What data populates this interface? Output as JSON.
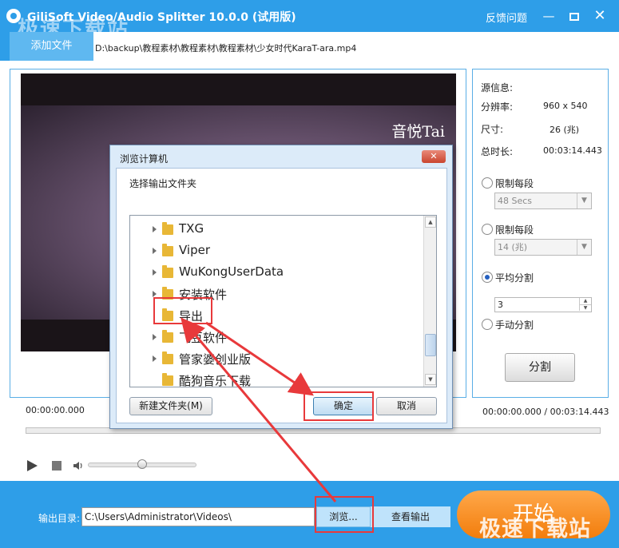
{
  "window": {
    "title": "GiliSoft Video/Audio Splitter 10.0.0 (试用版)",
    "feedback": "反馈问题",
    "minimize": "—",
    "close": "✕",
    "watermark": "极速下载站"
  },
  "toolbar": {
    "add_file": "添加文件",
    "file_path": "D:\\backup\\教程素材\\教程素材\\教程素材\\少女时代KaraT-ara.mp4"
  },
  "video": {
    "caption": "音悦Tai"
  },
  "info": {
    "source_label": "源信息:",
    "resolution_label": "分辨率:",
    "resolution_value": "960 x 540",
    "size_label": "尺寸:",
    "size_value": "26 (兆)",
    "duration_label": "总时长:",
    "duration_value": "00:03:14.443"
  },
  "split_options": {
    "limit_time_label": "限制每段",
    "limit_time_value": "48 Secs",
    "limit_size_label": "限制每段",
    "limit_size_value": "14 (兆)",
    "average_label": "平均分割",
    "average_value": "3",
    "manual_label": "手动分割",
    "split_button": "分割",
    "selected": "average"
  },
  "timeline": {
    "time_left": "00:00:00.000",
    "time_right": "00:00:00.000 / 00:03:14.443",
    "volume": 0.5
  },
  "output": {
    "label": "输出目录:",
    "path": "C:\\Users\\Administrator\\Videos\\",
    "browse": "浏览...",
    "view_output": "查看输出",
    "start": "开始"
  },
  "dialog": {
    "title": "浏览计算机",
    "close": "✕",
    "prompt": "选择输出文件夹",
    "folders": [
      {
        "name": "TXG",
        "has_children": true
      },
      {
        "name": "Viper",
        "has_children": true
      },
      {
        "name": "WuKongUserData",
        "has_children": true
      },
      {
        "name": "安装软件",
        "has_children": true
      },
      {
        "name": "导出",
        "has_children": false,
        "selected": true
      },
      {
        "name": "飞豆软件",
        "has_children": true
      },
      {
        "name": "管家婆创业版",
        "has_children": true
      },
      {
        "name": "酷狗音乐下载",
        "has_children": false
      }
    ],
    "new_folder": "新建文件夹(M)",
    "ok": "确定",
    "cancel": "取消"
  },
  "colors": {
    "accent": "#2e9ee8",
    "start_button": "#f58f22",
    "annotation": "#e8393b",
    "folder": "#e8b736"
  }
}
